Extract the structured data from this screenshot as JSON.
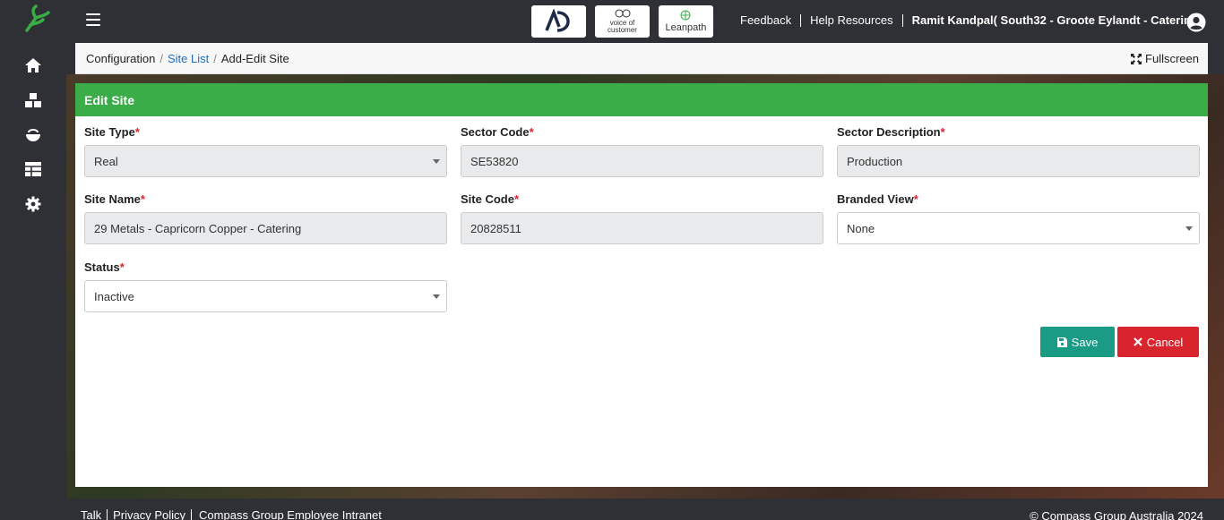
{
  "header": {
    "partners": [
      "AD",
      "voice of customer",
      "Leanpath"
    ],
    "links": [
      "Feedback",
      "Help Resources"
    ],
    "user": "Ramit Kandpal( South32 - Groote Eylandt - Catering )"
  },
  "breadcrumb": {
    "root": "Configuration",
    "parent": "Site List",
    "current": "Add-Edit Site",
    "fullscreen": "Fullscreen"
  },
  "card": {
    "title": "Edit Site"
  },
  "form": {
    "site_type": {
      "label": "Site Type",
      "value": "Real"
    },
    "sector_code": {
      "label": "Sector Code",
      "value": "SE53820"
    },
    "sector_description": {
      "label": "Sector Description",
      "value": "Production"
    },
    "site_name": {
      "label": "Site Name",
      "value": "29 Metals - Capricorn Copper - Catering"
    },
    "site_code": {
      "label": "Site Code",
      "value": "20828511"
    },
    "branded_view": {
      "label": "Branded View",
      "value": "None"
    },
    "status": {
      "label": "Status",
      "value": "Inactive"
    },
    "required_mark": "*"
  },
  "actions": {
    "save": "Save",
    "cancel": "Cancel"
  },
  "footer": {
    "links": [
      "Talk",
      "Privacy Policy",
      "Compass Group Employee Intranet"
    ],
    "copyright": "© Compass Group Australia 2024"
  },
  "colors": {
    "accent_green": "#3aac48",
    "save_teal": "#1a9b85",
    "cancel_red": "#d9232d",
    "sidebar_dark": "#2f3035"
  }
}
